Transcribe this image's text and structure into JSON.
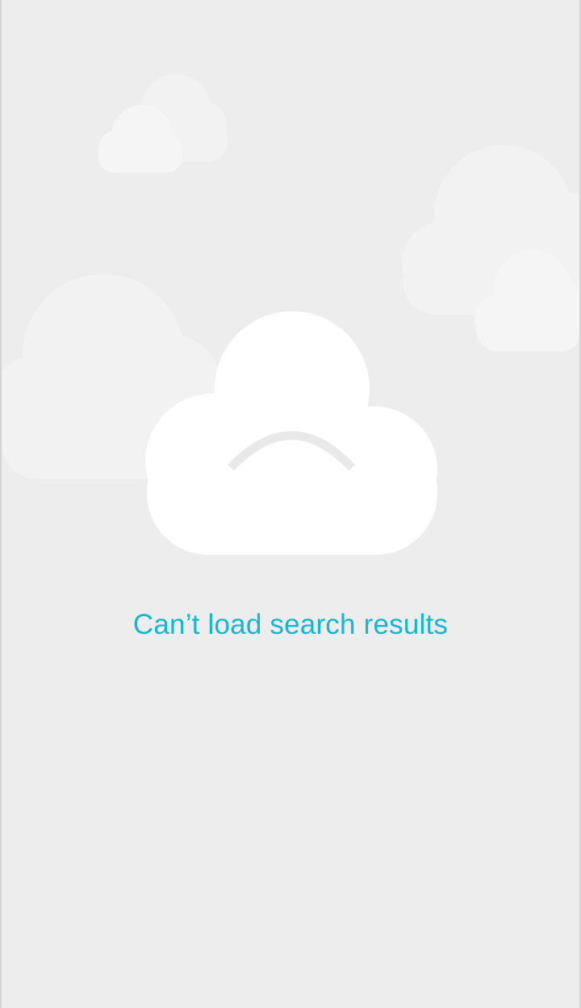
{
  "screen": {
    "message": "Can’t load search results",
    "main_illustration": "sad-cloud-icon",
    "background_illustrations": [
      "cloud-icon",
      "cloud-icon",
      "cloud-icon",
      "cloud-icon",
      "cloud-icon"
    ]
  },
  "colors": {
    "background": "#ededed",
    "message_text": "#12b8d1",
    "cloud_main": "#ffffff",
    "cloud_background": "#f5f5f5",
    "frown": "#e9e9e9"
  }
}
